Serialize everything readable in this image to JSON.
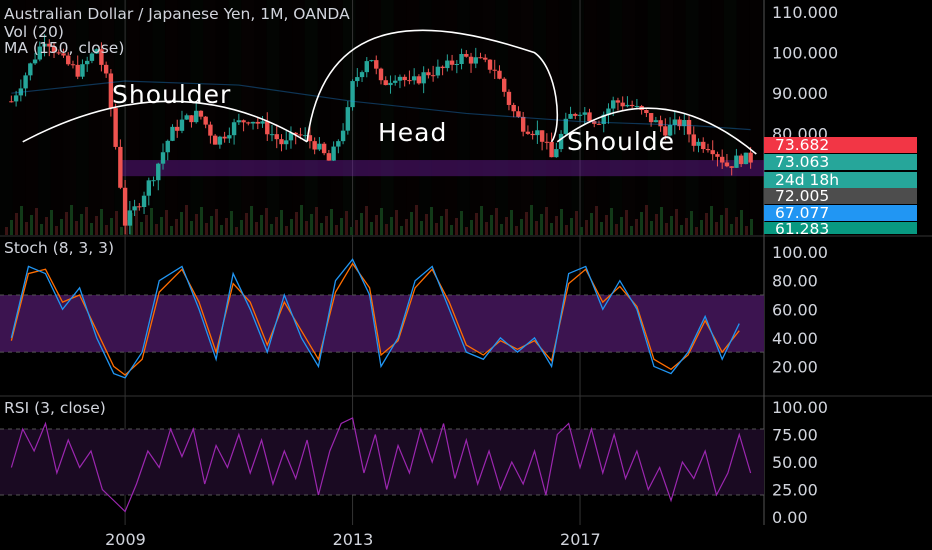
{
  "header": {
    "title": "Australian Dollar / Japanese Yen, 1M, OANDA",
    "vol_label": "Vol (20)",
    "ma_label": "MA (150, close)"
  },
  "annotations": {
    "left_shoulder": "Shoulder",
    "head": "Head",
    "right_shoulder": "Shoulde"
  },
  "price_labels": [
    {
      "text": "73.682",
      "bg": "#f23645"
    },
    {
      "text": "73.063",
      "bg": "#26a69a"
    },
    {
      "text": "24d 18h",
      "bg": "#26a69a"
    },
    {
      "text": "72.005",
      "bg": "#4d4d4d"
    },
    {
      "text": "67.077",
      "bg": "#2196f3"
    },
    {
      "text": "61.283",
      "bg": "#089981"
    }
  ],
  "colors": {
    "up": "#26a69a",
    "down": "#ef5350",
    "stoch_k": "#2196f3",
    "stoch_d": "#ff6d00",
    "rsi": "#9c27b0",
    "band": "#3c1450"
  },
  "chart_data": [
    {
      "type": "candlestick",
      "title": "Australian Dollar / Japanese Yen, 1M, OANDA",
      "yticks": [
        "110.000",
        "100.000",
        "90.000",
        "80.000"
      ],
      "ylim": [
        55,
        113
      ],
      "x_ticks": [
        "2009",
        "2013",
        "2017"
      ],
      "series": [
        {
          "name": "AUDJPY",
          "points": [
            [
              2007.0,
              88
            ],
            [
              2007.3,
              96
            ],
            [
              2007.6,
              104
            ],
            [
              2007.9,
              98
            ],
            [
              2008.2,
              95
            ],
            [
              2008.5,
              101
            ],
            [
              2008.7,
              92
            ],
            [
              2008.85,
              75
            ],
            [
              2009.0,
              58
            ],
            [
              2009.2,
              62
            ],
            [
              2009.5,
              70
            ],
            [
              2009.8,
              80
            ],
            [
              2010.0,
              83
            ],
            [
              2010.3,
              85
            ],
            [
              2010.6,
              78
            ],
            [
              2010.9,
              82
            ],
            [
              2011.2,
              84
            ],
            [
              2011.5,
              81
            ],
            [
              2011.8,
              77
            ],
            [
              2012.0,
              80
            ],
            [
              2012.3,
              78
            ],
            [
              2012.6,
              73
            ],
            [
              2012.9,
              84
            ],
            [
              2013.0,
              92
            ],
            [
              2013.3,
              100
            ],
            [
              2013.5,
              92
            ],
            [
              2013.8,
              95
            ],
            [
              2014.0,
              92
            ],
            [
              2014.3,
              95
            ],
            [
              2014.6,
              96
            ],
            [
              2014.9,
              99
            ],
            [
              2015.2,
              98
            ],
            [
              2015.5,
              96
            ],
            [
              2015.8,
              86
            ],
            [
              2016.0,
              82
            ],
            [
              2016.3,
              80
            ],
            [
              2016.5,
              74
            ],
            [
              2016.8,
              84
            ],
            [
              2017.0,
              86
            ],
            [
              2017.3,
              83
            ],
            [
              2017.6,
              88
            ],
            [
              2017.9,
              87
            ],
            [
              2018.2,
              84
            ],
            [
              2018.5,
              81
            ],
            [
              2018.8,
              83
            ],
            [
              2019.0,
              78
            ],
            [
              2019.3,
              77
            ],
            [
              2019.6,
              72
            ],
            [
              2019.8,
              74
            ],
            [
              2020.0,
              73.7
            ]
          ]
        }
      ],
      "ma_points": [
        [
          2007.0,
          90
        ],
        [
          2009.0,
          93
        ],
        [
          2011.0,
          92
        ],
        [
          2013.0,
          88
        ],
        [
          2015.0,
          85
        ],
        [
          2017.0,
          83
        ],
        [
          2019.0,
          82
        ],
        [
          2020.0,
          81
        ]
      ],
      "y_scale": "linear"
    },
    {
      "type": "line",
      "title": "Stoch (8, 3, 3)",
      "yticks": [
        "100.00",
        "80.00",
        "60.00",
        "40.00",
        "20.00"
      ],
      "ylim": [
        0,
        105
      ],
      "band": [
        30,
        70
      ],
      "series": [
        {
          "name": "%K",
          "points": [
            [
              2007.0,
              40
            ],
            [
              2007.3,
              90
            ],
            [
              2007.6,
              85
            ],
            [
              2007.9,
              60
            ],
            [
              2008.2,
              75
            ],
            [
              2008.5,
              40
            ],
            [
              2008.8,
              15
            ],
            [
              2009.0,
              12
            ],
            [
              2009.3,
              30
            ],
            [
              2009.6,
              80
            ],
            [
              2010.0,
              90
            ],
            [
              2010.3,
              60
            ],
            [
              2010.6,
              25
            ],
            [
              2010.9,
              85
            ],
            [
              2011.2,
              60
            ],
            [
              2011.5,
              30
            ],
            [
              2011.8,
              70
            ],
            [
              2012.1,
              40
            ],
            [
              2012.4,
              20
            ],
            [
              2012.7,
              80
            ],
            [
              2013.0,
              95
            ],
            [
              2013.3,
              70
            ],
            [
              2013.5,
              20
            ],
            [
              2013.8,
              40
            ],
            [
              2014.1,
              80
            ],
            [
              2014.4,
              90
            ],
            [
              2014.7,
              60
            ],
            [
              2015.0,
              30
            ],
            [
              2015.3,
              25
            ],
            [
              2015.6,
              40
            ],
            [
              2015.9,
              30
            ],
            [
              2016.2,
              40
            ],
            [
              2016.5,
              20
            ],
            [
              2016.8,
              85
            ],
            [
              2017.1,
              90
            ],
            [
              2017.4,
              60
            ],
            [
              2017.7,
              80
            ],
            [
              2018.0,
              60
            ],
            [
              2018.3,
              20
            ],
            [
              2018.6,
              15
            ],
            [
              2018.9,
              30
            ],
            [
              2019.2,
              55
            ],
            [
              2019.5,
              25
            ],
            [
              2019.8,
              50
            ]
          ]
        },
        {
          "name": "%D",
          "points": [
            [
              2007.0,
              38
            ],
            [
              2007.3,
              85
            ],
            [
              2007.6,
              88
            ],
            [
              2007.9,
              65
            ],
            [
              2008.2,
              70
            ],
            [
              2008.5,
              45
            ],
            [
              2008.8,
              20
            ],
            [
              2009.0,
              14
            ],
            [
              2009.3,
              25
            ],
            [
              2009.6,
              72
            ],
            [
              2010.0,
              88
            ],
            [
              2010.3,
              65
            ],
            [
              2010.6,
              30
            ],
            [
              2010.9,
              78
            ],
            [
              2011.2,
              65
            ],
            [
              2011.5,
              35
            ],
            [
              2011.8,
              65
            ],
            [
              2012.1,
              45
            ],
            [
              2012.4,
              25
            ],
            [
              2012.7,
              72
            ],
            [
              2013.0,
              92
            ],
            [
              2013.3,
              75
            ],
            [
              2013.5,
              28
            ],
            [
              2013.8,
              38
            ],
            [
              2014.1,
              75
            ],
            [
              2014.4,
              88
            ],
            [
              2014.7,
              65
            ],
            [
              2015.0,
              35
            ],
            [
              2015.3,
              28
            ],
            [
              2015.6,
              38
            ],
            [
              2015.9,
              32
            ],
            [
              2016.2,
              38
            ],
            [
              2016.5,
              24
            ],
            [
              2016.8,
              78
            ],
            [
              2017.1,
              88
            ],
            [
              2017.4,
              65
            ],
            [
              2017.7,
              76
            ],
            [
              2018.0,
              62
            ],
            [
              2018.3,
              25
            ],
            [
              2018.6,
              18
            ],
            [
              2018.9,
              28
            ],
            [
              2019.2,
              52
            ],
            [
              2019.5,
              30
            ],
            [
              2019.8,
              45
            ]
          ]
        }
      ]
    },
    {
      "type": "line",
      "title": "RSI (3, close)",
      "yticks": [
        "100.00",
        "75.00",
        "50.00",
        "25.00",
        "0.00"
      ],
      "ylim": [
        0,
        100
      ],
      "band": [
        20,
        80
      ],
      "series": [
        {
          "name": "RSI",
          "points": [
            [
              2007.0,
              45
            ],
            [
              2007.2,
              80
            ],
            [
              2007.4,
              60
            ],
            [
              2007.6,
              85
            ],
            [
              2007.8,
              40
            ],
            [
              2008.0,
              70
            ],
            [
              2008.2,
              45
            ],
            [
              2008.4,
              60
            ],
            [
              2008.6,
              25
            ],
            [
              2008.8,
              15
            ],
            [
              2009.0,
              5
            ],
            [
              2009.2,
              30
            ],
            [
              2009.4,
              60
            ],
            [
              2009.6,
              45
            ],
            [
              2009.8,
              80
            ],
            [
              2010.0,
              55
            ],
            [
              2010.2,
              80
            ],
            [
              2010.4,
              30
            ],
            [
              2010.6,
              65
            ],
            [
              2010.8,
              45
            ],
            [
              2011.0,
              75
            ],
            [
              2011.2,
              40
            ],
            [
              2011.4,
              70
            ],
            [
              2011.6,
              30
            ],
            [
              2011.8,
              60
            ],
            [
              2012.0,
              35
            ],
            [
              2012.2,
              70
            ],
            [
              2012.4,
              20
            ],
            [
              2012.6,
              60
            ],
            [
              2012.8,
              85
            ],
            [
              2013.0,
              90
            ],
            [
              2013.2,
              40
            ],
            [
              2013.4,
              75
            ],
            [
              2013.6,
              25
            ],
            [
              2013.8,
              65
            ],
            [
              2014.0,
              40
            ],
            [
              2014.2,
              80
            ],
            [
              2014.4,
              50
            ],
            [
              2014.6,
              85
            ],
            [
              2014.8,
              35
            ],
            [
              2015.0,
              70
            ],
            [
              2015.2,
              30
            ],
            [
              2015.4,
              60
            ],
            [
              2015.6,
              25
            ],
            [
              2015.8,
              50
            ],
            [
              2016.0,
              30
            ],
            [
              2016.2,
              60
            ],
            [
              2016.4,
              20
            ],
            [
              2016.6,
              75
            ],
            [
              2016.8,
              85
            ],
            [
              2017.0,
              45
            ],
            [
              2017.2,
              80
            ],
            [
              2017.4,
              40
            ],
            [
              2017.6,
              75
            ],
            [
              2017.8,
              35
            ],
            [
              2018.0,
              60
            ],
            [
              2018.2,
              25
            ],
            [
              2018.4,
              45
            ],
            [
              2018.6,
              15
            ],
            [
              2018.8,
              50
            ],
            [
              2019.0,
              35
            ],
            [
              2019.2,
              60
            ],
            [
              2019.4,
              20
            ],
            [
              2019.6,
              40
            ],
            [
              2019.8,
              75
            ],
            [
              2020.0,
              40
            ]
          ]
        }
      ]
    }
  ],
  "stoch_panel": {
    "title": "Stoch (8, 3, 3)"
  },
  "rsi_panel": {
    "title": "RSI (3, close)"
  }
}
